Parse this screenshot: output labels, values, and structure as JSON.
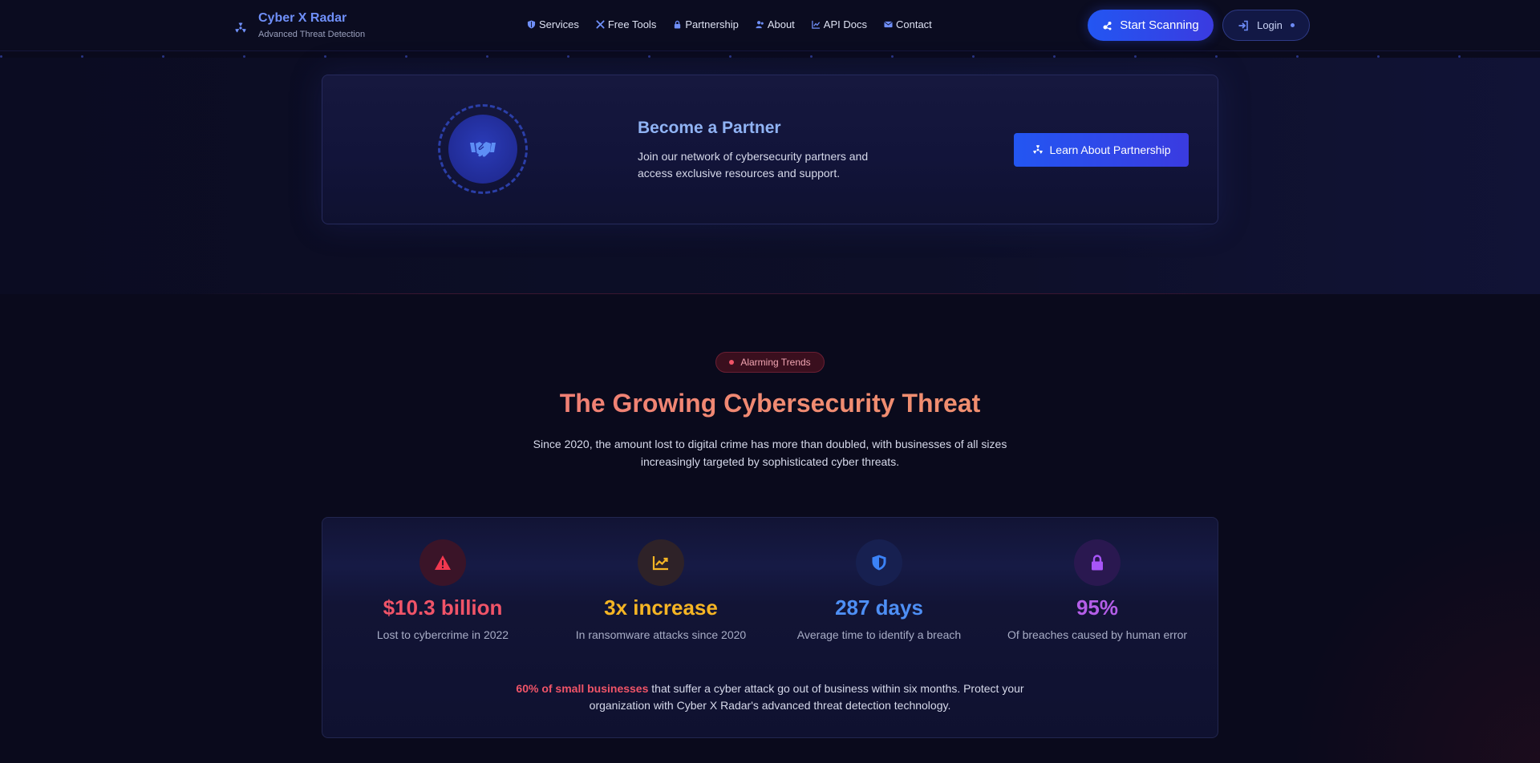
{
  "nav": {
    "brand": {
      "title": "Cyber X Radar",
      "subtitle": "Advanced Threat Detection",
      "icon": "radiation-icon"
    },
    "links": [
      {
        "label": "Services",
        "icon": "shield-icon"
      },
      {
        "label": "Free Tools",
        "icon": "tools-icon"
      },
      {
        "label": "Partnership",
        "icon": "lock-icon"
      },
      {
        "label": "About",
        "icon": "users-icon"
      },
      {
        "label": "API Docs",
        "icon": "chart-line-icon"
      },
      {
        "label": "Contact",
        "icon": "envelope-icon"
      }
    ],
    "scan_button": "Start Scanning",
    "login_button": "Login"
  },
  "partner": {
    "title": "Become a Partner",
    "description": "Join our network of cybersecurity partners and access exclusive resources and support.",
    "button": "Learn About Partnership",
    "icon": "handshake-icon"
  },
  "threat": {
    "badge": "Alarming Trends",
    "title": "The Growing Cybersecurity Threat",
    "description": "Since 2020, the amount lost to digital crime has more than doubled, with businesses of all sizes increasingly targeted by sophisticated cyber threats.",
    "stats": [
      {
        "value": "$10.3 billion",
        "label": "Lost to cybercrime in 2022",
        "color": "#f05468",
        "icon": "warning-icon"
      },
      {
        "value": "3x increase",
        "label": "In ransomware attacks since 2020",
        "color": "#f5b524",
        "icon": "chart-up-icon"
      },
      {
        "value": "287 days",
        "label": "Average time to identify a breach",
        "color": "#4e8ff5",
        "icon": "shield-icon"
      },
      {
        "value": "95%",
        "label": "Of breaches caused by human error",
        "color": "#b45ee8",
        "icon": "lock-icon"
      }
    ],
    "note_highlight": "60% of small businesses",
    "note_rest": " that suffer a cyber attack go out of business within six months. Protect your organization with Cyber X Radar's advanced threat detection technology."
  }
}
